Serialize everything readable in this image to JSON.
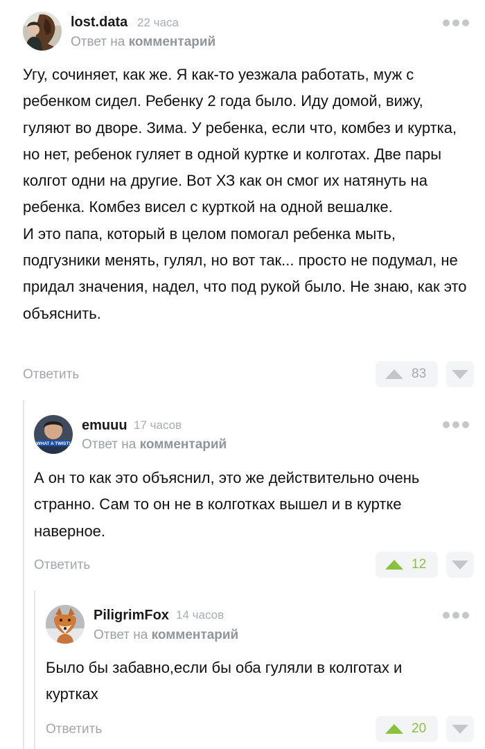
{
  "comments": [
    {
      "user": "lost.data",
      "time": "22 часа",
      "reply_prefix": "Ответ на",
      "reply_target": "комментарий",
      "text": "Угу, сочиняет, как же. Я как-то уезжала работать, муж с ребенком сидел. Ребенку 2 года было. Иду домой, вижу, гуляют во дворе. Зима. У ребенка, если что, комбез и куртка, но нет, ребенок гуляет в одной куртке и колготах. Две пары колгот одни на другие. Вот ХЗ как он смог их натянуть на ребенка. Комбез висел с курткой на одной вешалке.\nИ это папа, который в целом помогал ребенка мыть, подгузники менять, гулял, но вот так... просто не подумал, не придал значения, надел, что под рукой было. Не знаю, как это объяснить.",
      "reply_label": "Ответить",
      "rating": "83",
      "rating_color": "#a5aab0",
      "avatar": "woman-with-horse"
    },
    {
      "user": "emuuu",
      "time": "17 часов",
      "reply_prefix": "Ответ на",
      "reply_target": "комментарий",
      "text": "А он то как это объяснил, это же действительно  очень странно. Сам то он не в колготках вышел и в куртке наверное.",
      "reply_label": "Ответить",
      "rating": "12",
      "rating_color": "#8ac13c",
      "avatar": "what-a-twist-meme",
      "avatar_caption": "WHAT A TWIST!"
    },
    {
      "user": "PiligrimFox",
      "time": "14 часов",
      "reply_prefix": "Ответ на",
      "reply_target": "комментарий",
      "text": "Было бы забавно,если бы оба гуляли в колготах и куртках",
      "reply_label": "Ответить",
      "rating": "20",
      "rating_color": "#8ac13c",
      "avatar": "fox"
    }
  ]
}
